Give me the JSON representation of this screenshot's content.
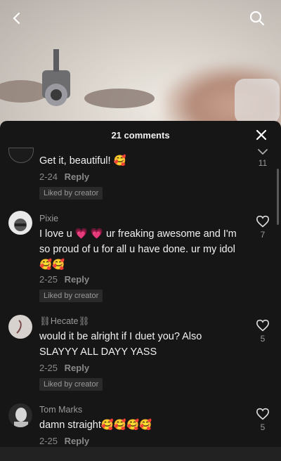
{
  "nav": {
    "back_icon": "chevron-left-icon",
    "search_icon": "search-icon"
  },
  "sheet": {
    "comment_count_label": "21 comments",
    "close_icon": "close-icon"
  },
  "comments": [
    {
      "username": "",
      "text": "Get it, beautiful! 🥰",
      "date": "2-24",
      "reply_label": "Reply",
      "liked_by_creator": "Liked by creator",
      "likes": "11"
    },
    {
      "username": "Pixie",
      "text": "I love u 💗 💗 ur freaking awesome and I'm so proud of u for all u have done. ur my idol 🥰🥰",
      "date": "2-25",
      "reply_label": "Reply",
      "liked_by_creator": "Liked by creator",
      "likes": "7"
    },
    {
      "username": "⛓Hecate⛓",
      "text": "would it be alright if I duet you? Also SLAYYY ALL DAYY YASS",
      "date": "2-25",
      "reply_label": "Reply",
      "liked_by_creator": "Liked by creator",
      "likes": "5"
    },
    {
      "username": "Tom Marks",
      "text": "damn straight🥰🥰🥰🥰",
      "date": "2-25",
      "reply_label": "Reply",
      "likes": "5"
    }
  ],
  "colors": {
    "sheet_bg": "#161616",
    "text": "#f1f1f1",
    "muted": "#9a9a9a",
    "badge_bg": "#2a2a2a"
  }
}
